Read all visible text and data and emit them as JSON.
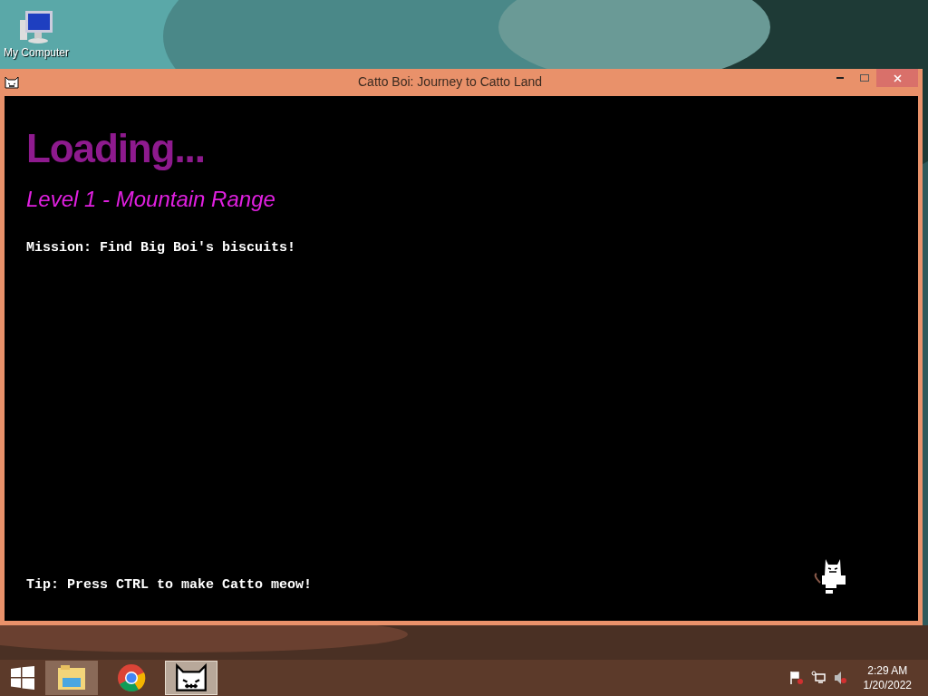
{
  "desktop_icons": [
    {
      "label": "My Computer"
    }
  ],
  "window": {
    "title": "Catto Boi: Journey to Catto Land"
  },
  "game": {
    "heading": "Loading...",
    "level_name": "Level 1 - Mountain Range",
    "mission": "Mission: Find Big Boi's biscuits!",
    "tip": "Tip: Press CTRL to make Catto meow!"
  },
  "taskbar": {
    "apps": [
      {
        "kind": "explorer",
        "selected": false
      },
      {
        "kind": "chrome",
        "selected": false
      },
      {
        "kind": "catto",
        "selected": true
      }
    ],
    "time": "2:29 AM",
    "date": "1/20/2022"
  }
}
